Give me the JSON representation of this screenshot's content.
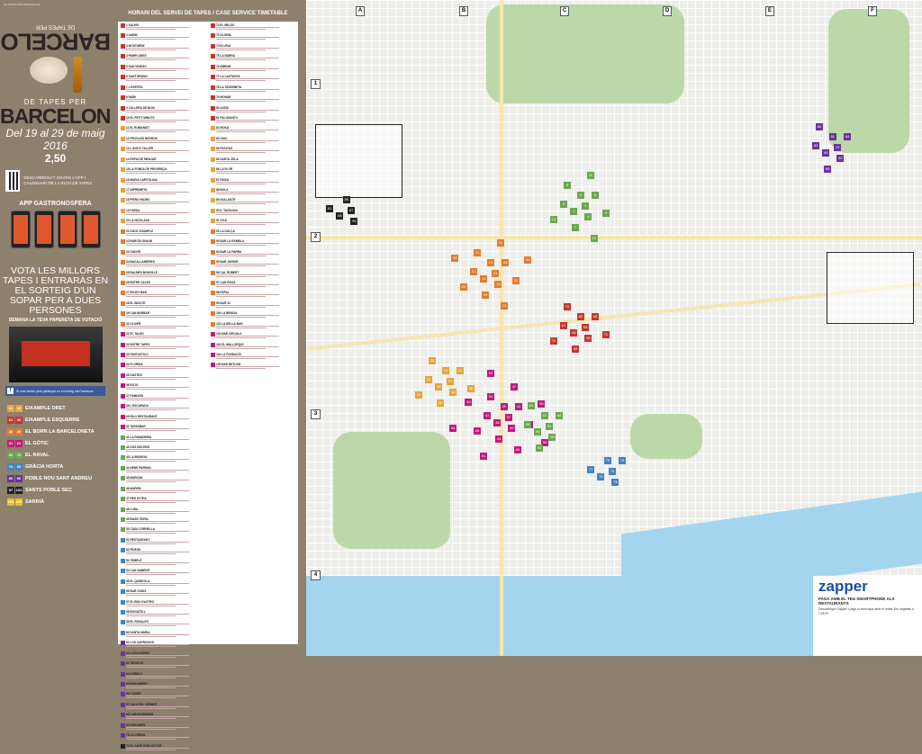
{
  "left_panel": {
    "brand_de": "DE TAPES PER",
    "brand_city": "BARCELONA",
    "brand_dates": "Del 19 al 29 de maig 2016",
    "brand_price": "2,50",
    "qr_text": "DESCARREGA'T GRATIS L'APP I CALENDARI DE LA RUTA DE TAPES",
    "app_label": "APP GASTRONOSFERA",
    "vote_text": "VOTA LES MILLORS TAPES I ENTRARÀS EN EL SORTEIG D'UN SOPAR PER A DUES PERSONES",
    "vote_sub": "DEMANA LA TEVA PAPERETA DE VOTACIÓ",
    "fb_text": "Si vols també pots participar en el sorteig via Facebook",
    "legend": [
      {
        "label": "EIXAMPLE DRET",
        "chips": [
          "01",
          "20"
        ],
        "color": "#e8a33a"
      },
      {
        "label": "EIXAMPLE ESQUERRE",
        "chips": [
          "21",
          "30"
        ],
        "color": "#c8352e"
      },
      {
        "label": "EL BORN LA BARCELONETA",
        "chips": [
          "36",
          "49"
        ],
        "color": "#e37c2c"
      },
      {
        "label": "EL GÒTIC",
        "chips": [
          "51",
          "61"
        ],
        "color": "#c1197b"
      },
      {
        "label": "EL RAVAL",
        "chips": [
          "62",
          "73"
        ],
        "color": "#6aa84f"
      },
      {
        "label": "GRÀCIA HORTA",
        "chips": [
          "74",
          "85"
        ],
        "color": "#3d85c6"
      },
      {
        "label": "POBLE NOU SANT ANDREU",
        "chips": [
          "86",
          "96"
        ],
        "color": "#6a329f"
      },
      {
        "label": "SANTS POBLE SEC",
        "chips": [
          "97",
          "102"
        ],
        "color": "#222222"
      },
      {
        "label": "SARRIÀ",
        "chips": [
          "103",
          "105"
        ],
        "color": "#e7c20f"
      }
    ]
  },
  "schedule": {
    "title": "HORARI DEL SERVEI DE TAPES / CASE SERVICE TIMETABLE",
    "col1": [
      "1 SALMÓ",
      "2 DARIK",
      "3 MOSTARDE",
      "4 PAMPLONES",
      "5 SAN VINEGO",
      "6 SANT BRUNO",
      "7 L'ESPITEL",
      "8 RAÏM",
      "9 CULLERA DE BOIX",
      "10 EL PETIT MINUTS",
      "11 EL RUMANIST",
      "12 FRIJOLES NEGROS",
      "13 L'ANTIC TALLER",
      "14 ESPAI DE MENJAR",
      "15 LA FONDA DE PROVENÇA",
      "16 MAFIA CAPITOLINA",
      "17 IMPREMPTA",
      "18 PIERO PADRO",
      "19 FARDA",
      "20 LA NICOLASA",
      "21 DOCK EXAMPLE",
      "22 BARCELONA 86",
      "23 GADOR",
      "24 BACALLANERIES",
      "25 BALMES BONVILLE",
      "26 ENTRE CALES",
      "27 ENJOY BAR",
      "28 EL BIGOTE",
      "29 CAN BARBAR",
      "30 OLIVER",
      "31 EL TALED",
      "32 ENTRE TAPES",
      "33 FANTASTICO",
      "34 FLORIDA",
      "35 GASTRO",
      "36 ROJO",
      "37 PAMIANO",
      "38 L'ESCAPADA",
      "39 RILO RESTAURANT",
      "40 TAPASBAR",
      "41 LA PANADERIA",
      "42 DOS DELFINS",
      "43 LA BODEGA",
      "44 NENE PARRAN",
      "45 MARZAN",
      "46 MAREM",
      "47 RED EXTRA",
      "48 LUNA",
      "49 BASIC ESPAI",
      "50 CASA CORNELLA",
      "51 RESTAURANT",
      "52 FIDEOS",
      "53 TEMPLE",
      "54 CAN SAMENIT",
      "55 EL QUINDOLA",
      "56 BAR CODIS",
      "57 EL BOU GASTRO",
      "58 BOGATELL",
      "59 EL ROSALES",
      "60 SANTA MARIA",
      "61 LOS CAPRICHOS",
      "62 LOCUS BORN",
      "63 TAPAS 24",
      "64 AGRELO",
      "65 BUKANEIRO",
      "66 COSMO",
      "67 CALA DEL VERMUT",
      "68 CARLIN MARIAN",
      "69 GOKUMEN",
      "70 LA CREMA",
      "71 EL CAFÈ D'EN VICTOR"
    ],
    "col2": [
      "72 EL BELOU",
      "73 GLÒRIA",
      "74 ELUSIA",
      "75 LA BARRA",
      "76 AMBOR",
      "77 LA CASTANYA",
      "78 LA TAVERNETA",
      "79 MONAR",
      "80 ASSIS",
      "81 PALOSANTO",
      "82 MOKA",
      "83 GUIU",
      "84 PATATAS",
      "85 SANTA CELA",
      "86 LA FLOR",
      "87 PAISA",
      "88 BOLA",
      "89 AVALANTE",
      "90 IL TAVOLINO",
      "91 GOJI",
      "92 LA DOLÇA",
      "93 BAR LA RAMBLA",
      "94 BAR LA PARRA",
      "95 BAR JUNIOR",
      "96 CAL ROBERT",
      "97 CAN ROSA",
      "98 ESPAI",
      "99 BAR 33",
      "100 LA BRUIXA",
      "101 LA BELLA BAR",
      "102 BAR CIRCULO",
      "103 EL MALLORQUÍ",
      "104 LA FUNDACIÓ",
      "105 BAR BETLEM"
    ]
  },
  "map": {
    "col_labels": [
      "A",
      "B",
      "C",
      "D",
      "E",
      "F"
    ],
    "row_labels": [
      "1",
      "2",
      "3",
      "4"
    ]
  },
  "zapper": {
    "logo": "zapper",
    "headline": "PAGA AMB EL TEU SMARTPHONE ALS RESTAURANTS",
    "body": "Descarrega't Zapper i paga la teva tapa amb el mòbil. Els vegetals a 1,95 €*"
  }
}
